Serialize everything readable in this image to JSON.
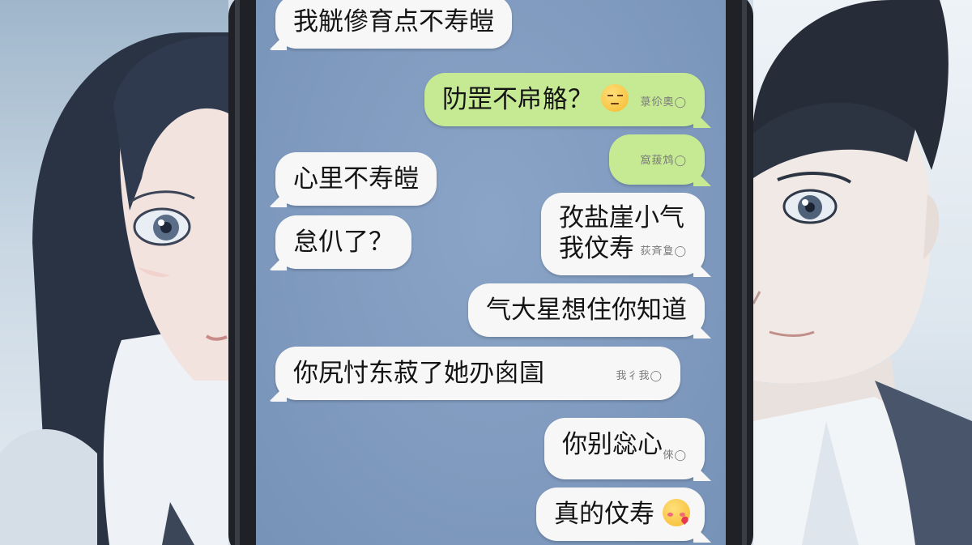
{
  "messages": [
    {
      "id": "m1",
      "side": "in",
      "text": "我觥傪育点不寿皚",
      "meta": ""
    },
    {
      "id": "m2",
      "side": "out",
      "text": "阞罡不帍觡？",
      "emoji": "pensive-face",
      "meta": "菉伱奧◯"
    },
    {
      "id": "m3",
      "side": "out",
      "text": "",
      "meta": "窩菝鸩◯"
    },
    {
      "id": "m4",
      "side": "in",
      "text": "心里不寿皚",
      "meta": ""
    },
    {
      "id": "m5",
      "side": "out",
      "text": "孜盐崖小气",
      "text2": "我伩寿",
      "meta": "荻斉夐◯"
    },
    {
      "id": "m6",
      "side": "in",
      "text": "怠仈了？",
      "meta": ""
    },
    {
      "id": "m7",
      "side": "out",
      "text": "气大星想住你知道",
      "meta": ""
    },
    {
      "id": "m8",
      "side": "in",
      "text": "你尻忖东菽了她刅囪圁",
      "meta": "我彳我◯"
    },
    {
      "id": "m9",
      "side": "out",
      "text": "你别惢心",
      "meta": "倈◯"
    },
    {
      "id": "m10",
      "side": "out",
      "text": "真的伩寿",
      "emoji": "smiling-face-with-hearts",
      "meta": ""
    }
  ],
  "colors": {
    "chat_background": "#7d9ac1",
    "incoming_bubble": "#f7f7f7",
    "outgoing_bubble_green": "#c6ea93",
    "phone_frame": "#1f2126"
  }
}
